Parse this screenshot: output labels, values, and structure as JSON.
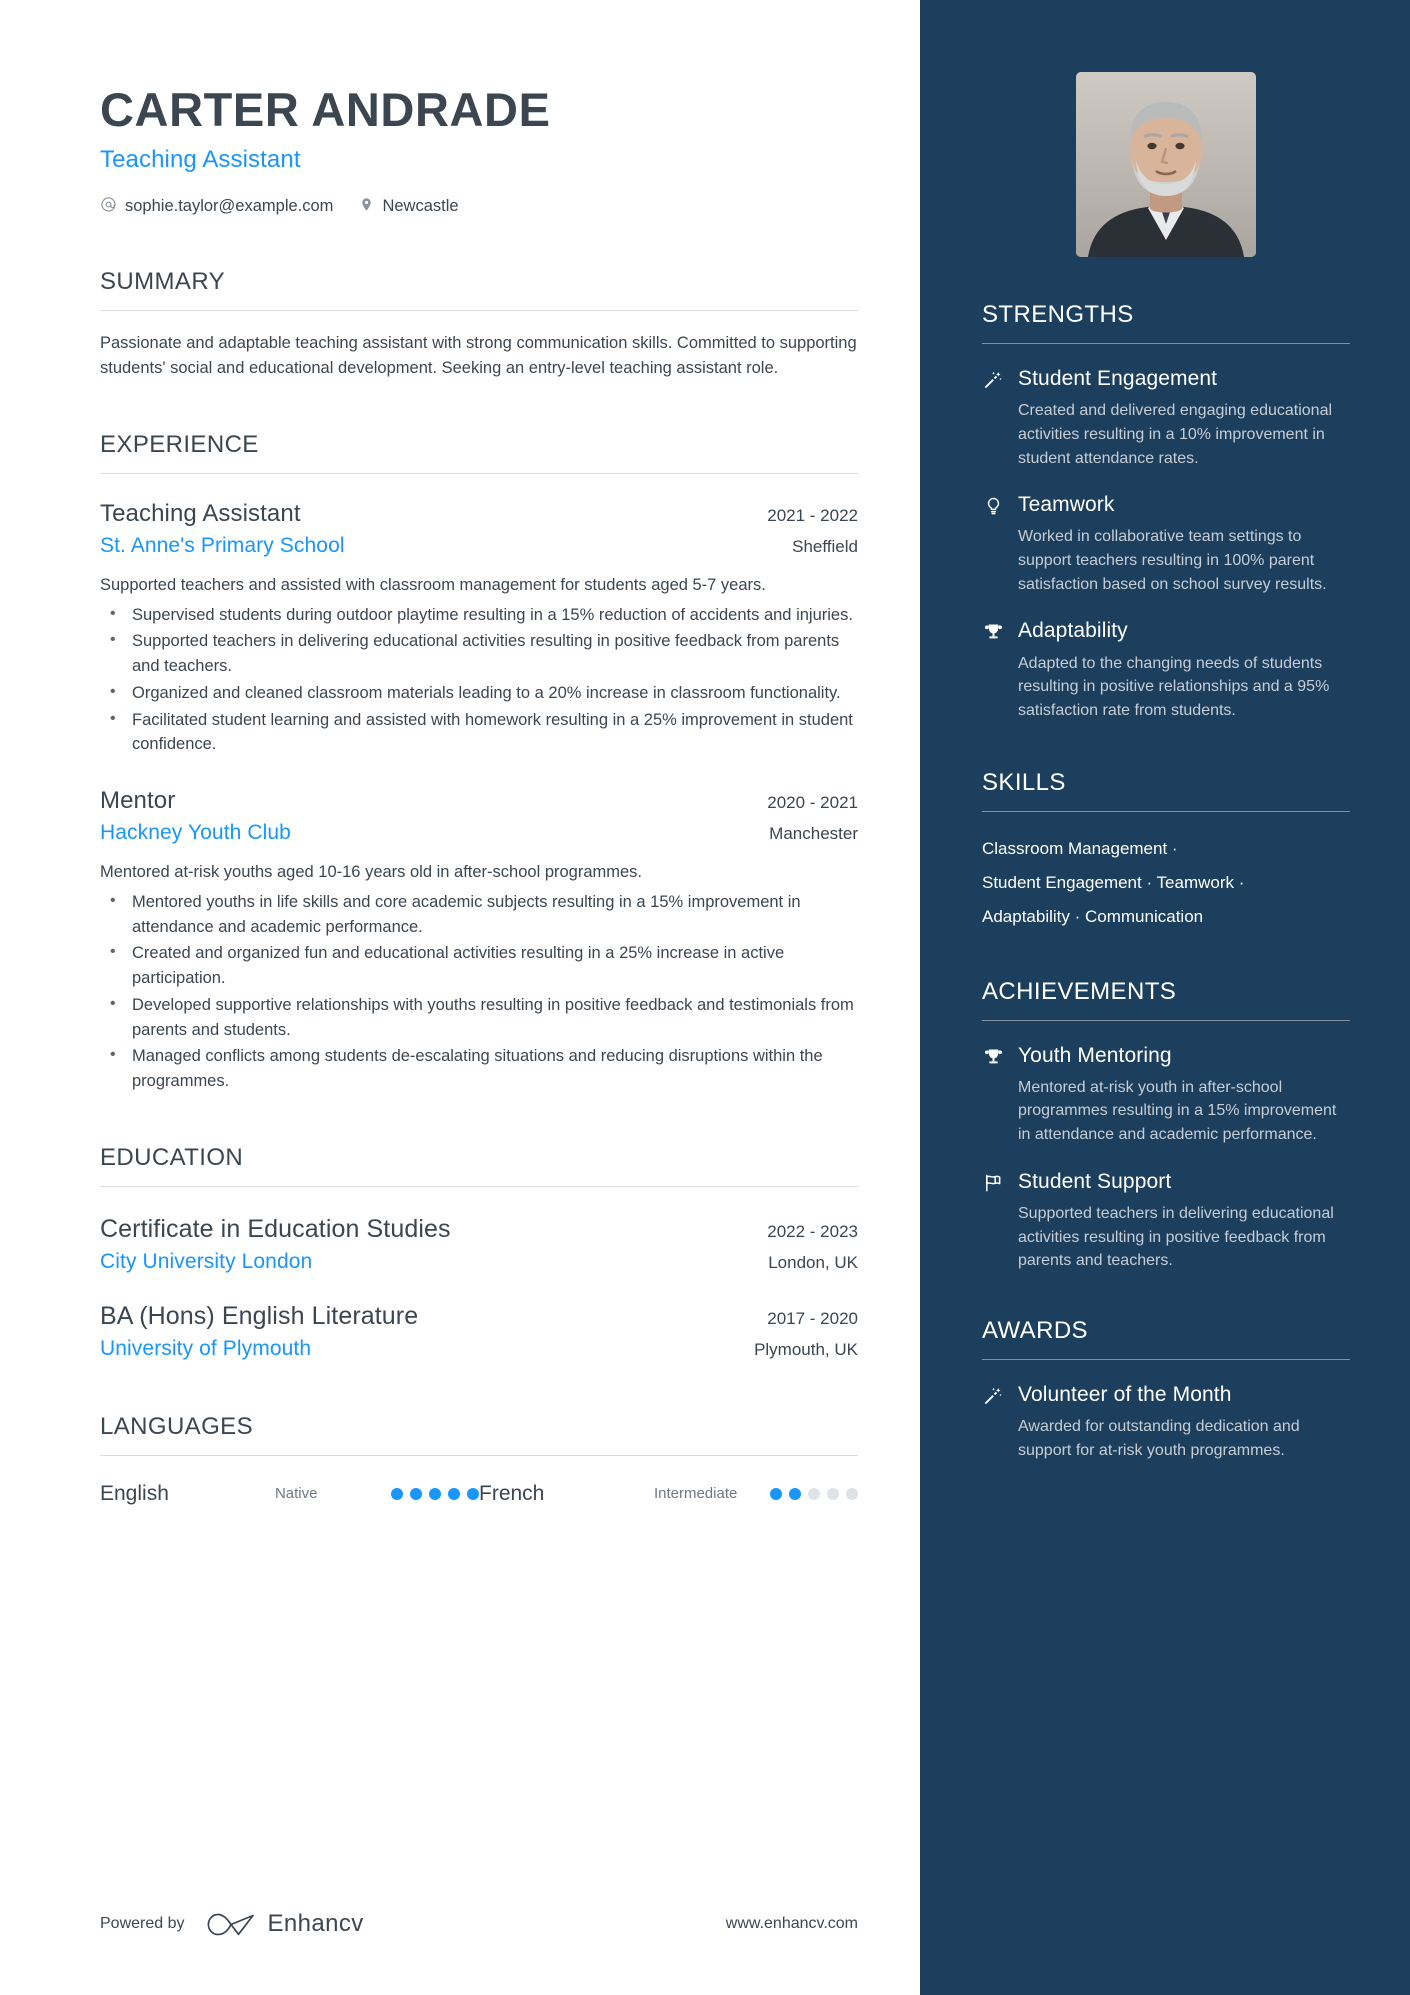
{
  "header": {
    "name": "CARTER ANDRADE",
    "role": "Teaching Assistant",
    "email": "sophie.taylor@example.com",
    "location": "Newcastle"
  },
  "summary": {
    "heading": "SUMMARY",
    "text": "Passionate and adaptable teaching assistant with strong communication skills. Committed to supporting students' social and educational development. Seeking an entry-level teaching assistant role."
  },
  "experience": {
    "heading": "EXPERIENCE",
    "entries": [
      {
        "title": "Teaching Assistant",
        "dates": "2021 - 2022",
        "org": "St. Anne's Primary School",
        "location": "Sheffield",
        "desc": "Supported teachers and assisted with classroom management for students aged 5-7 years.",
        "bullets": [
          "Supervised students during outdoor playtime resulting in a 15% reduction of accidents and injuries.",
          "Supported teachers in delivering educational activities resulting in positive feedback from parents and teachers.",
          "Organized and cleaned classroom materials leading to a 20% increase in classroom functionality.",
          "Facilitated student learning and assisted with homework resulting in a 25% improvement in student confidence."
        ]
      },
      {
        "title": "Mentor",
        "dates": "2020 - 2021",
        "org": "Hackney Youth Club",
        "location": "Manchester",
        "desc": "Mentored at-risk youths aged 10-16 years old in after-school programmes.",
        "bullets": [
          "Mentored youths in life skills and core academic subjects resulting in a 15% improvement in attendance and academic performance.",
          "Created and organized fun and educational activities resulting in a 25% increase in active participation.",
          "Developed supportive relationships with youths resulting in positive feedback and testimonials from parents and students.",
          "Managed conflicts among students de-escalating situations and reducing disruptions within the programmes."
        ]
      }
    ]
  },
  "education": {
    "heading": "EDUCATION",
    "entries": [
      {
        "degree": "Certificate in Education Studies",
        "dates": "2022 - 2023",
        "school": "City University London",
        "location": "London, UK"
      },
      {
        "degree": "BA (Hons) English Literature",
        "dates": "2017 - 2020",
        "school": "University of Plymouth",
        "location": "Plymouth, UK"
      }
    ]
  },
  "languages": {
    "heading": "LANGUAGES",
    "items": [
      {
        "name": "English",
        "level": "Native",
        "dots_filled": 5,
        "dots_total": 5
      },
      {
        "name": "French",
        "level": "Intermediate",
        "dots_filled": 2,
        "dots_total": 5
      }
    ]
  },
  "footer": {
    "powered_by": "Powered by",
    "brand": "Enhancv",
    "website": "www.enhancv.com"
  },
  "strengths": {
    "heading": "STRENGTHS",
    "items": [
      {
        "icon": "magic-wand-icon",
        "title": "Student Engagement",
        "desc": "Created and delivered engaging educational activities resulting in a 10% improvement in student attendance rates."
      },
      {
        "icon": "lightbulb-icon",
        "title": "Teamwork",
        "desc": "Worked in collaborative team settings to support teachers resulting in 100% parent satisfaction based on school survey results."
      },
      {
        "icon": "trophy-icon",
        "title": "Adaptability",
        "desc": "Adapted to the changing needs of students resulting in positive relationships and a 95% satisfaction rate from students."
      }
    ]
  },
  "skills": {
    "heading": "SKILLS",
    "lines": [
      "Classroom Management ·",
      "Student Engagement · Teamwork ·",
      "Adaptability · Communication"
    ]
  },
  "achievements": {
    "heading": "ACHIEVEMENTS",
    "items": [
      {
        "icon": "trophy-icon",
        "title": "Youth Mentoring",
        "desc": "Mentored at-risk youth in after-school programmes resulting in a 15% improvement in attendance and academic performance."
      },
      {
        "icon": "flag-icon",
        "title": "Student Support",
        "desc": "Supported teachers in delivering educational activities resulting in positive feedback from parents and teachers."
      }
    ]
  },
  "awards": {
    "heading": "AWARDS",
    "items": [
      {
        "icon": "magic-wand-icon",
        "title": "Volunteer of the Month",
        "desc": "Awarded for outstanding dedication and support for at-risk youth programmes."
      }
    ]
  },
  "colors": {
    "accent_blue": "#1896fc",
    "sidebar_bg": "#1d3f5e",
    "text_dark": "#3c4650"
  }
}
